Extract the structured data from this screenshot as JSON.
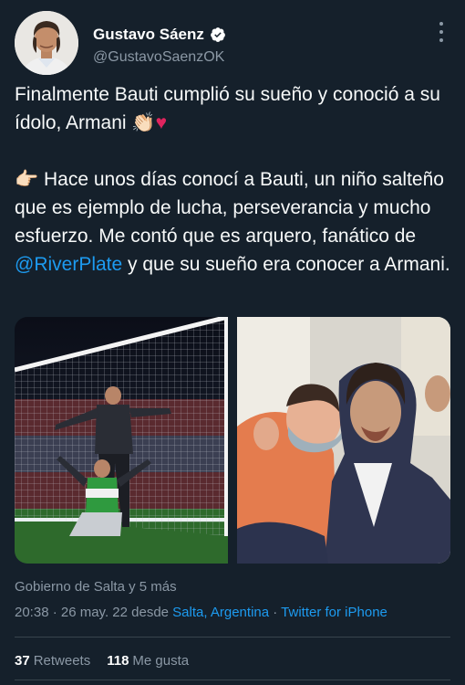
{
  "author": {
    "name": "Gustavo Sáenz",
    "handle": "@GustavoSaenzOK"
  },
  "tweet": {
    "line1": "Finalmente Bauti cumplió su sueño y conoció a su ídolo, Armani ",
    "emoji1": "👏🏻",
    "emoji2": "♥",
    "emoji_point": "👉🏻",
    "line2_pre": " Hace unos días conocí a Bauti, un niño salteño que es ejemplo de lucha, perseverancia y mucho esfuerzo. Me contó que es arquero, fanático de ",
    "mention": "@RiverPlate",
    "line2_post": " y que su sueño era conocer a Armani."
  },
  "tagged": "Gobierno de Salta y 5 más",
  "meta": {
    "time": "20:38 · 26 may. 22 desde ",
    "location": "Salta, Argentina",
    "sep": " · ",
    "client": "Twitter for iPhone"
  },
  "stats": {
    "retweets_count": "37",
    "retweets_label": "Retweets",
    "likes_count": "118",
    "likes_label": "Me gusta"
  },
  "colors": {
    "background": "#15202b",
    "link": "#1d9bf0",
    "secondary": "#8b98a5"
  }
}
